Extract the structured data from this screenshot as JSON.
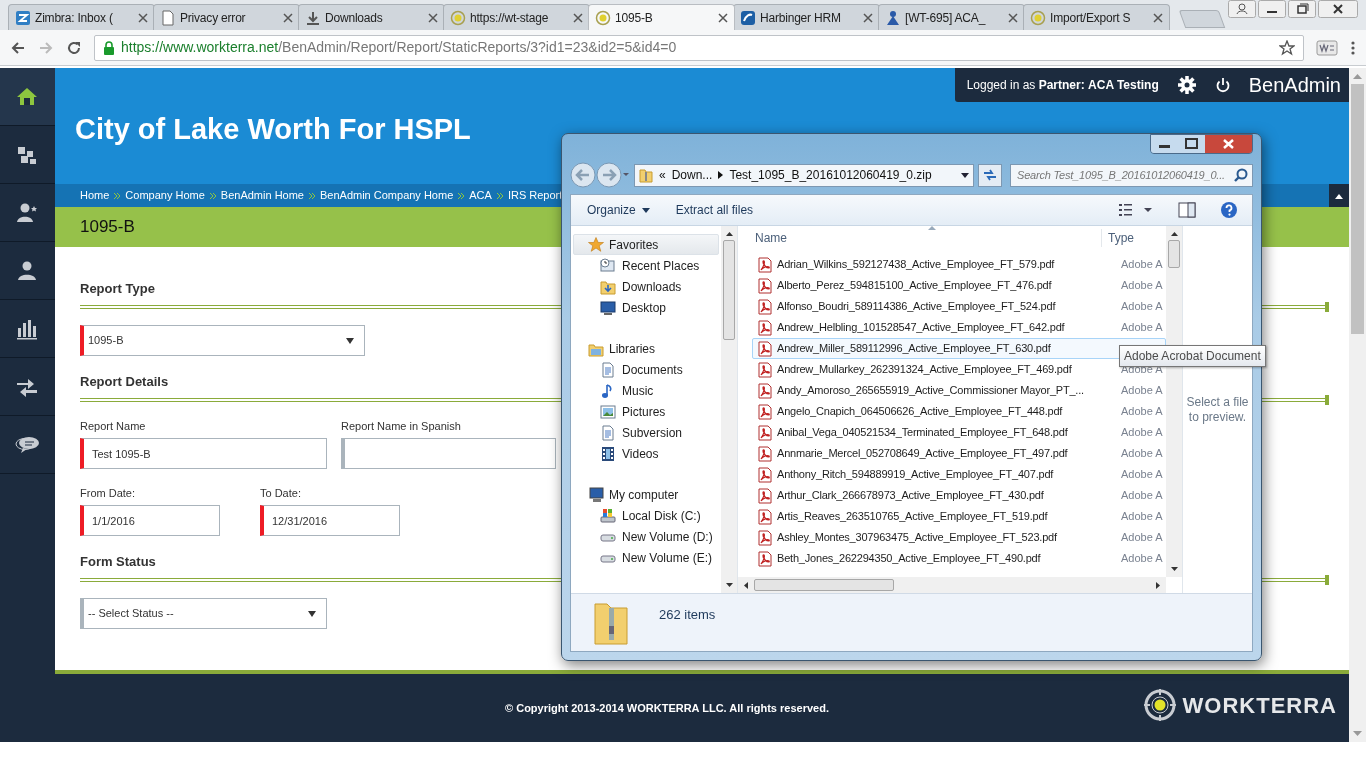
{
  "browser": {
    "tabs": [
      {
        "title": "Zimbra: Inbox (",
        "kind": "mail",
        "selected": false
      },
      {
        "title": "Privacy error",
        "kind": "page",
        "selected": false
      },
      {
        "title": "Downloads",
        "kind": "download",
        "selected": false
      },
      {
        "title": "https://wt-stage",
        "kind": "site",
        "selected": false
      },
      {
        "title": "1095-B",
        "kind": "site",
        "selected": true
      },
      {
        "title": "Harbinger HRM",
        "kind": "app",
        "selected": false
      },
      {
        "title": "[WT-695] ACA_",
        "kind": "tracker",
        "selected": false
      },
      {
        "title": "Import/Export S",
        "kind": "site",
        "selected": false
      }
    ],
    "url": {
      "host": "https://www.workterra.net",
      "path": "/BenAdmin/Report/Report/StaticReports/3?id1=23&id2=5&id4=0"
    }
  },
  "app": {
    "user_bar": {
      "prefix": "Logged in as",
      "role": "Partner:",
      "name": "ACA Testing",
      "product": "BenAdmin"
    },
    "sidebar": [
      {
        "kind": "home",
        "selected": true
      },
      {
        "kind": "modules",
        "selected": false
      },
      {
        "kind": "user-star",
        "selected": false
      },
      {
        "kind": "user",
        "selected": false
      },
      {
        "kind": "chart",
        "selected": false
      },
      {
        "kind": "transfer",
        "selected": false
      },
      {
        "kind": "chat",
        "selected": false
      }
    ],
    "company_title": "City of Lake Worth For HSPL",
    "breadcrumb": [
      "Home",
      "Company Home",
      "BenAdmin Home",
      "BenAdmin Company Home",
      "ACA",
      "IRS Report"
    ],
    "page_title": "1095-B",
    "sections": [
      {
        "heading": "Report Type",
        "rows": [
          [
            {
              "kind": "select",
              "value": "1095-B",
              "required": true
            }
          ]
        ]
      },
      {
        "heading": "Report Details",
        "rows": [
          [
            {
              "kind": "input",
              "label": "Report Name",
              "value": "Test 1095-B",
              "required": true
            },
            {
              "kind": "input",
              "label": "Report Name in Spanish",
              "required": false
            }
          ],
          [
            {
              "kind": "input",
              "label": "From Date:",
              "value": "1/1/2016",
              "required": true
            },
            {
              "kind": "input",
              "label": "To Date:",
              "value": "12/31/2016",
              "required": true
            }
          ]
        ]
      },
      {
        "heading": "Form Status",
        "rows": [
          [
            {
              "kind": "select",
              "value": "-- Select Status --",
              "required": false
            }
          ]
        ]
      }
    ],
    "footer": {
      "copyright": "© Copyright 2013-2014 WORKTERRA LLC. All rights reserved.",
      "logo": "WORKTERRA"
    }
  },
  "explorer": {
    "address": [
      "Down...",
      "Test_1095_B_20161012060419_0.zip"
    ],
    "address_prefix": "«",
    "search_placeholder": "Search Test_1095_B_20161012060419_0...",
    "toolbar": [
      "Organize",
      "Extract all files"
    ],
    "nav": [
      {
        "label": "Favorites",
        "kind": "star",
        "selected": true,
        "children": [
          {
            "label": "Recent Places",
            "kind": "recent"
          },
          {
            "label": "Downloads",
            "kind": "downloads"
          },
          {
            "label": "Desktop",
            "kind": "desktop"
          }
        ]
      },
      {
        "label": "Libraries",
        "kind": "library",
        "selected": false,
        "children": [
          {
            "label": "Documents",
            "kind": "documents"
          },
          {
            "label": "Music",
            "kind": "music"
          },
          {
            "label": "Pictures",
            "kind": "pictures"
          },
          {
            "label": "Subversion",
            "kind": "documents"
          },
          {
            "label": "Videos",
            "kind": "videos"
          }
        ]
      },
      {
        "label": "My computer",
        "kind": "computer",
        "selected": false,
        "children": [
          {
            "label": "Local Disk (C:)",
            "kind": "system-disk"
          },
          {
            "label": "New Volume (D:)",
            "kind": "drive"
          },
          {
            "label": "New Volume (E:)",
            "kind": "drive"
          }
        ]
      }
    ],
    "columns": [
      "Name",
      "Type"
    ],
    "files": [
      {
        "name": "Adrian_Wilkins_592127438_Active_Employee_FT_579.pdf",
        "type": "Adobe A",
        "hovered": false
      },
      {
        "name": "Alberto_Perez_594815100_Active_Employee_FT_476.pdf",
        "type": "Adobe A",
        "hovered": false
      },
      {
        "name": "Alfonso_Boudri_589114386_Active_Employee_FT_524.pdf",
        "type": "Adobe A",
        "hovered": false
      },
      {
        "name": "Andrew_Helbling_101528547_Active_Employee_FT_642.pdf",
        "type": "Adobe A",
        "hovered": false
      },
      {
        "name": "Andrew_Miller_589112996_Active_Employee_FT_630.pdf",
        "hovered": true
      },
      {
        "name": "Andrew_Mullarkey_262391324_Active_Employee_FT_469.pdf",
        "type": "Adobe A",
        "hovered": false
      },
      {
        "name": "Andy_Amoroso_265655919_Active_Commissioner Mayor_PT_...",
        "type": "Adobe A",
        "hovered": false
      },
      {
        "name": "Angelo_Cnapich_064506626_Active_Employee_FT_448.pdf",
        "type": "Adobe A",
        "hovered": false
      },
      {
        "name": "Anibal_Vega_040521534_Terminated_Employee_FT_648.pdf",
        "type": "Adobe A",
        "hovered": false
      },
      {
        "name": "Annmarie_Mercel_052708649_Active_Employee_FT_497.pdf",
        "type": "Adobe A",
        "hovered": false
      },
      {
        "name": "Anthony_Ritch_594889919_Active_Employee_FT_407.pdf",
        "type": "Adobe A",
        "hovered": false
      },
      {
        "name": "Arthur_Clark_266678973_Active_Employee_FT_430.pdf",
        "type": "Adobe A",
        "hovered": false
      },
      {
        "name": "Artis_Reaves_263510765_Active_Employee_FT_519.pdf",
        "type": "Adobe A",
        "hovered": false
      },
      {
        "name": "Ashley_Montes_307963475_Active_Employee_FT_523.pdf",
        "type": "Adobe A",
        "hovered": false
      },
      {
        "name": "Beth_Jones_262294350_Active_Employee_FT_490.pdf",
        "type": "Adobe A",
        "hovered": false
      }
    ],
    "tooltip": "Adobe Acrobat Document",
    "preview_hint": "Select a file to preview.",
    "status": "262 items"
  }
}
